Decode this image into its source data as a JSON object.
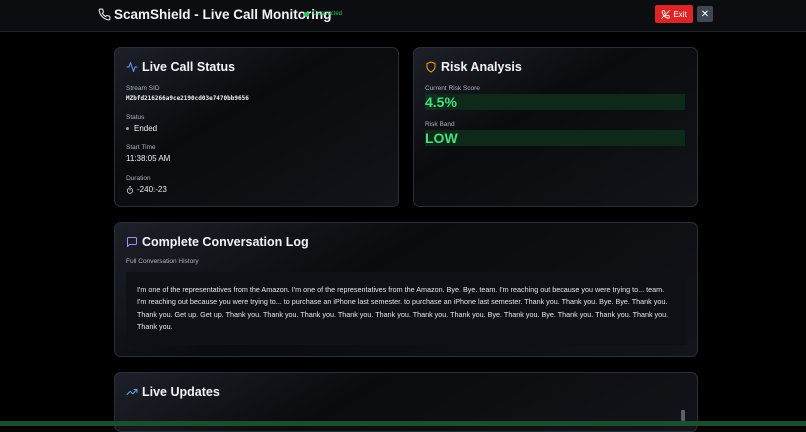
{
  "header": {
    "title": "ScamShield - Live Call Monitoring",
    "connection_status": "Connected",
    "exit_label": "Exit",
    "close_label": "✕"
  },
  "live_call_status": {
    "title": "Live Call Status",
    "stream_sid_label": "Stream SID",
    "stream_sid": "MZbfd216266a9ce2190cd03e7470bb9656",
    "status_label": "Status",
    "status": "Ended",
    "start_time_label": "Start Time",
    "start_time": "11:38:05 AM",
    "duration_label": "Duration",
    "duration": "-240:-23"
  },
  "risk_analysis": {
    "title": "Risk Analysis",
    "score_label": "Current Risk Score",
    "score": "4.5%",
    "score_value": 0.045,
    "band_label": "Risk Band",
    "band": "LOW",
    "accent_color": "#4ade80"
  },
  "conversation": {
    "title": "Complete Conversation Log",
    "history_label": "Full Conversation History",
    "text": "I'm one of the representatives from the Amazon. I'm one of the representatives from the Amazon. Bye. Bye. team. I'm reaching out because you were trying to... team. I'm reaching out because you were trying to... to purchase an iPhone last semester. to purchase an iPhone last semester. Thank you. Thank you. Bye. Bye. Thank you. Thank you. Get up. Get up. Thank you. Thank you. Thank you. Thank you. Thank you. Thank you. Thank you. Bye. Thank you. Bye. Thank you. Thank you. Thank you. Thank you."
  },
  "live_updates": {
    "title": "Live Updates"
  },
  "icons": {
    "phone": "phone-icon",
    "exit": "phone-off-icon",
    "activity": "activity-icon",
    "shield": "shield-icon",
    "message": "message-square-icon",
    "trend": "trending-up-icon",
    "timer": "timer-icon"
  }
}
